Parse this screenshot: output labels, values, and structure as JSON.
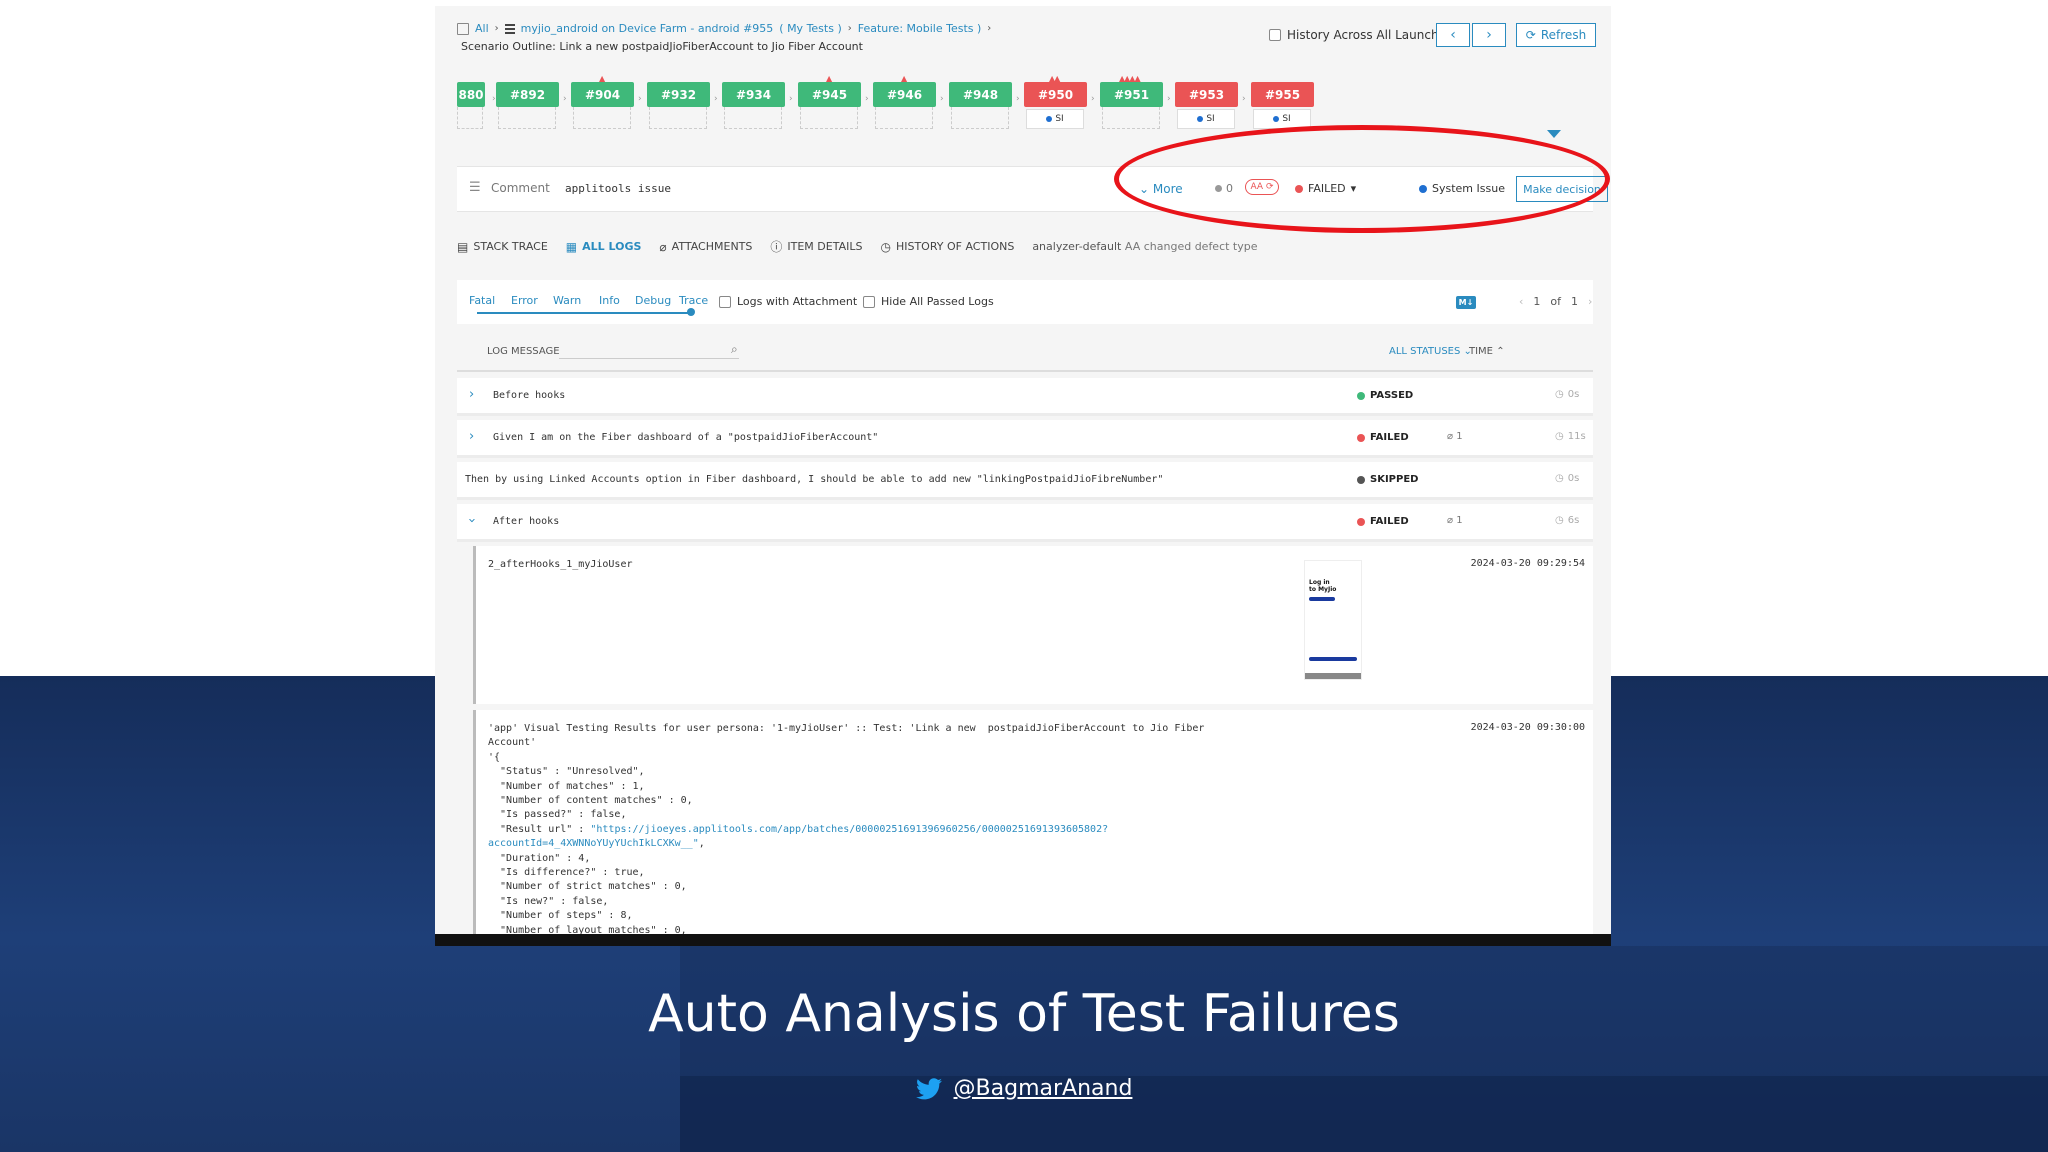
{
  "breadcrumbs": {
    "all": "All",
    "launch": "myjio_android on Device Farm - android #955",
    "my_tests": "( My Tests )",
    "feature": "Feature: Mobile Tests )"
  },
  "scenario": "Scenario Outline: Link a new postpaidJioFiberAccount to Jio Fiber Account",
  "history_label": "History Across All Launches",
  "nav": {
    "prev": "‹",
    "next": "›",
    "refresh": "Refresh"
  },
  "launches": [
    {
      "label": "880",
      "status": "passed",
      "si": ""
    },
    {
      "label": "#892",
      "status": "passed",
      "si": ""
    },
    {
      "label": "#904",
      "status": "passed",
      "si": "",
      "marks": "▲"
    },
    {
      "label": "#932",
      "status": "passed",
      "si": ""
    },
    {
      "label": "#934",
      "status": "passed",
      "si": ""
    },
    {
      "label": "#945",
      "status": "passed",
      "si": "",
      "marks": "▲"
    },
    {
      "label": "#946",
      "status": "passed",
      "si": "",
      "marks": "▲"
    },
    {
      "label": "#948",
      "status": "passed",
      "si": ""
    },
    {
      "label": "#950",
      "status": "failed",
      "si": "SI",
      "marks": "▲▲"
    },
    {
      "label": "#951",
      "status": "passed",
      "si": "",
      "marks": "▲▲▲▲"
    },
    {
      "label": "#953",
      "status": "failed",
      "si": "SI"
    },
    {
      "label": "#955",
      "status": "failed",
      "si": "SI"
    }
  ],
  "comment": {
    "label": "Comment",
    "text": "applitools issue"
  },
  "defect": {
    "more": "More",
    "count": "0",
    "aa": "AA",
    "status": "FAILED",
    "issue": "System Issue",
    "decision": "Make decision"
  },
  "tabs": [
    {
      "label": "STACK TRACE",
      "icon": "clipboard-icon"
    },
    {
      "label": "ALL LOGS",
      "icon": "logs-icon"
    },
    {
      "label": "ATTACHMENTS",
      "icon": "paperclip-icon"
    },
    {
      "label": "ITEM DETAILS",
      "icon": "info-icon"
    },
    {
      "label": "HISTORY OF ACTIONS",
      "icon": "clock-icon"
    }
  ],
  "analyzer": {
    "name": "analyzer-default",
    "action": "AA changed defect type"
  },
  "levels": [
    "Fatal",
    "Error",
    "Warn",
    "Info",
    "Debug",
    "Trace"
  ],
  "filters": {
    "with_attachment": "Logs with Attachment",
    "hide_passed": "Hide All Passed Logs",
    "md": "M↓"
  },
  "pager": {
    "prev": "‹",
    "current": "1",
    "of": "of",
    "total": "1",
    "next": "›"
  },
  "log_header": {
    "message": "LOG MESSAGE",
    "statuses": "ALL STATUSES",
    "time": "TIME"
  },
  "rows": [
    {
      "text": "Before hooks",
      "status": "PASSED",
      "attach": "",
      "dur": "0s"
    },
    {
      "text": "Given I am on the Fiber dashboard of a \"postpaidJioFiberAccount\"",
      "status": "FAILED",
      "attach": "1",
      "dur": "11s"
    },
    {
      "text": "Then by using Linked Accounts option in Fiber dashboard, I should be able to add new \"linkingPostpaidJioFibreNumber\"",
      "status": "SKIPPED",
      "attach": "",
      "dur": "0s"
    },
    {
      "text": "After hooks",
      "status": "FAILED",
      "attach": "1",
      "dur": "6s"
    }
  ],
  "log_entries": [
    {
      "text": "2_afterHooks_1_myJioUser",
      "date": "2024-03-20 09:29:54",
      "thumb_title": "Log in\nto MyJio"
    },
    {
      "line1": "'app' Visual Testing Results for user persona: '1-myJioUser' :: Test: 'Link a new  postpaidJioFiberAccount to Jio Fiber",
      "line2": "Account'",
      "line3": "'{",
      "line4": "  \"Status\" : \"Unresolved\",",
      "line5": "  \"Number of matches\" : 1,",
      "line6": "  \"Number of content matches\" : 0,",
      "line7": "  \"Is passed?\" : false,",
      "line8a": "  \"Result url\" : ",
      "line8b": "\"https://jioeyes.applitools.com/app/batches/00000251691396960256/00000251691393605802?",
      "line9": "accountId=4_4XWNNoYUyYUchIkLCXKw__\"",
      "line9b": ",",
      "line10": "  \"Duration\" : 4,",
      "line11": "  \"Is difference?\" : true,",
      "line12": "  \"Number of strict matches\" : 0,",
      "line13": "  \"Is new?\" : false,",
      "line14": "  \"Number of steps\" : 8,",
      "line15": "  \"Number of layout matches\" : 0,",
      "date": "2024-03-20 09:30:00"
    }
  ],
  "slide": {
    "title": "Auto Analysis of Test Failures",
    "handle": "@BagmarAnand"
  },
  "colors": {
    "accent": "#2a8bbf",
    "passed": "#3fb97a",
    "failed": "#ea5455",
    "skipped": "#555555",
    "highlight": "#e8141a"
  }
}
